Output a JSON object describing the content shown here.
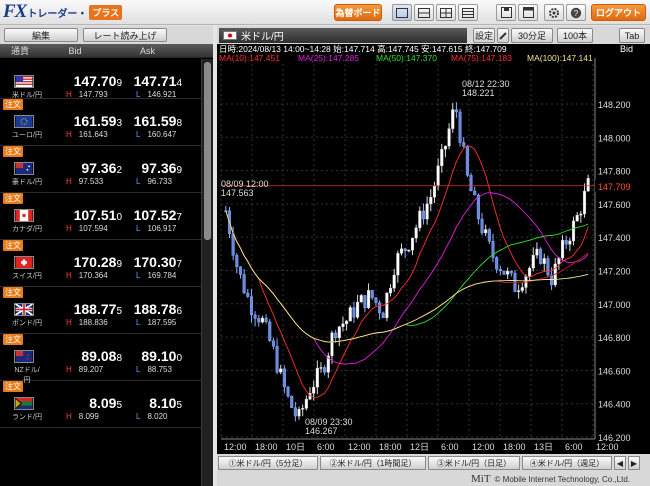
{
  "app": {
    "logo_main": "FX",
    "logo_sub": "トレーダー・",
    "logo_plus": "プラス"
  },
  "toolbar": {
    "kawase_board": "為替ボード",
    "logout": "ログアウト"
  },
  "rate_panel": {
    "edit_button": "編集",
    "rate_read_button": "レート読み上げ",
    "columns": {
      "pair": "通貨",
      "bid": "Bid",
      "ask": "Ask"
    },
    "order_label": "注文",
    "rows": [
      {
        "pair": "米ドル/円",
        "flag": "us",
        "bid_main": "147.70",
        "bid_last": "9",
        "ask_main": "147.71",
        "ask_last": "4",
        "high": "147.793",
        "low": "146.921",
        "order": false
      },
      {
        "pair": "ユーロ/円",
        "flag": "eu",
        "bid_main": "161.59",
        "bid_last": "3",
        "ask_main": "161.59",
        "ask_last": "8",
        "high": "161.643",
        "low": "160.647",
        "order": true
      },
      {
        "pair": "豪ドル/円",
        "flag": "au",
        "bid_main": "97.36",
        "bid_last": "2",
        "ask_main": "97.36",
        "ask_last": "9",
        "high": "97.533",
        "low": "96.733",
        "order": true
      },
      {
        "pair": "カナダ/円",
        "flag": "ca",
        "bid_main": "107.51",
        "bid_last": "0",
        "ask_main": "107.52",
        "ask_last": "7",
        "high": "107.594",
        "low": "106.917",
        "order": true
      },
      {
        "pair": "スイス/円",
        "flag": "ch",
        "bid_main": "170.28",
        "bid_last": "9",
        "ask_main": "170.30",
        "ask_last": "7",
        "high": "170.364",
        "low": "169.784",
        "order": true
      },
      {
        "pair": "ポンド/円",
        "flag": "gb",
        "bid_main": "188.77",
        "bid_last": "5",
        "ask_main": "188.78",
        "ask_last": "6",
        "high": "188.836",
        "low": "187.595",
        "order": true
      },
      {
        "pair": "NZドル/円",
        "flag": "nz",
        "bid_main": "89.08",
        "bid_last": "8",
        "ask_main": "89.10",
        "ask_last": "0",
        "high": "89.207",
        "low": "88.753",
        "order": true
      },
      {
        "pair": "ランド/円",
        "flag": "za",
        "bid_main": "8.09",
        "bid_last": "5",
        "ask_main": "8.10",
        "ask_last": "5",
        "high": "8.099",
        "low": "8.020",
        "order": true
      }
    ],
    "high_mark": "H",
    "low_mark": "L"
  },
  "chart": {
    "title": "米ドル/円",
    "settings_button": "設定",
    "period_button": "30分足",
    "count_button": "100本",
    "tab_button": "Tab",
    "info_line": "日時:2024/08/13 14:00~14:28 始:147.714 高:147.745 安:147.615 終:147.709",
    "ma": [
      {
        "text": "MA(10):147.451",
        "color": "#ff3030"
      },
      {
        "text": "MA(25):147.285",
        "color": "#e020e0"
      },
      {
        "text": "MA(50):147.370",
        "color": "#30e030"
      },
      {
        "text": "MA(75):147.183",
        "color": "#ff3030"
      },
      {
        "text": "MA(100):147.141",
        "color": "#f0e68c"
      }
    ],
    "bid_label": "Bid",
    "current_price": "147.709",
    "y_ticks": [
      "148.200",
      "148.000",
      "147.800",
      "147.600",
      "147.400",
      "147.200",
      "147.000",
      "146.800",
      "146.600",
      "146.400",
      "146.200"
    ],
    "x_ticks": [
      "12:00",
      "18:00",
      "10日",
      "6:00",
      "12:00",
      "18:00",
      "12日",
      "6:00",
      "12:00",
      "18:00",
      "13日",
      "6:00",
      "12:00"
    ],
    "annotations": [
      {
        "time": "08/12 22:30",
        "price": "148.221"
      },
      {
        "time": "08/09 12:00",
        "price": "147.563"
      },
      {
        "time": "08/09 23:30",
        "price": "146.267"
      }
    ]
  },
  "bottom_tabs": [
    "①米ドル/円（5分足）",
    "②米ドル/円（1時間足）",
    "③米ドル/円（日足）",
    "④米ドル/円（週足）"
  ],
  "footer": {
    "mit": "MiT",
    "copyright": "© Mobile Internet Technology, Co.,Ltd."
  }
}
